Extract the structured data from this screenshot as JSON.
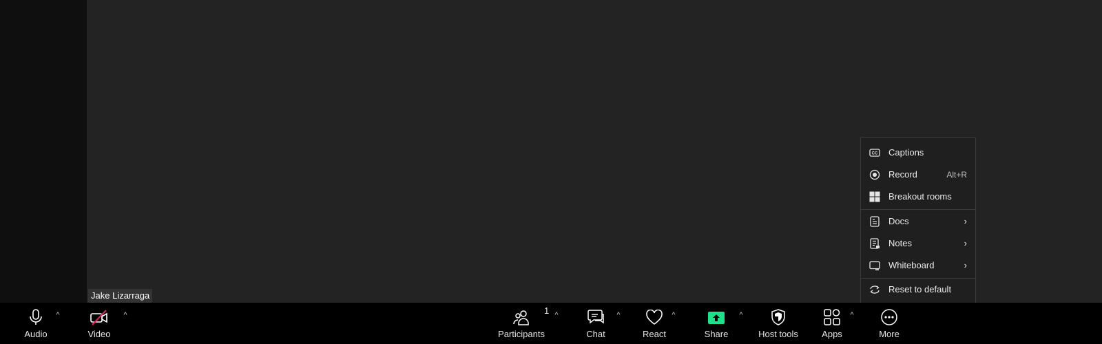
{
  "participant": {
    "name": "Jake Lizarraga"
  },
  "toolbar": {
    "audio_label": "Audio",
    "video_label": "Video",
    "participants_label": "Participants",
    "participants_count": "1",
    "chat_label": "Chat",
    "react_label": "React",
    "share_label": "Share",
    "host_tools_label": "Host tools",
    "apps_label": "Apps",
    "more_label": "More",
    "caret": "^"
  },
  "menu": {
    "items": [
      {
        "label": "Captions",
        "icon": "cc-icon"
      },
      {
        "label": "Record",
        "shortcut": "Alt+R",
        "icon": "record-icon"
      },
      {
        "label": "Breakout rooms",
        "icon": "breakout-rooms-icon"
      },
      {
        "label": "Docs",
        "icon": "docs-icon",
        "chevron": "›"
      },
      {
        "label": "Notes",
        "icon": "notes-icon",
        "chevron": "›"
      },
      {
        "label": "Whiteboard",
        "icon": "whiteboard-icon",
        "chevron": "›"
      },
      {
        "label": "Reset to default",
        "icon": "reset-icon"
      }
    ]
  },
  "colors": {
    "share_accent": "#1ee08b",
    "video_off_slash": "#e0245e",
    "toolbar_bg": "#000000",
    "video_bg": "#232323"
  }
}
